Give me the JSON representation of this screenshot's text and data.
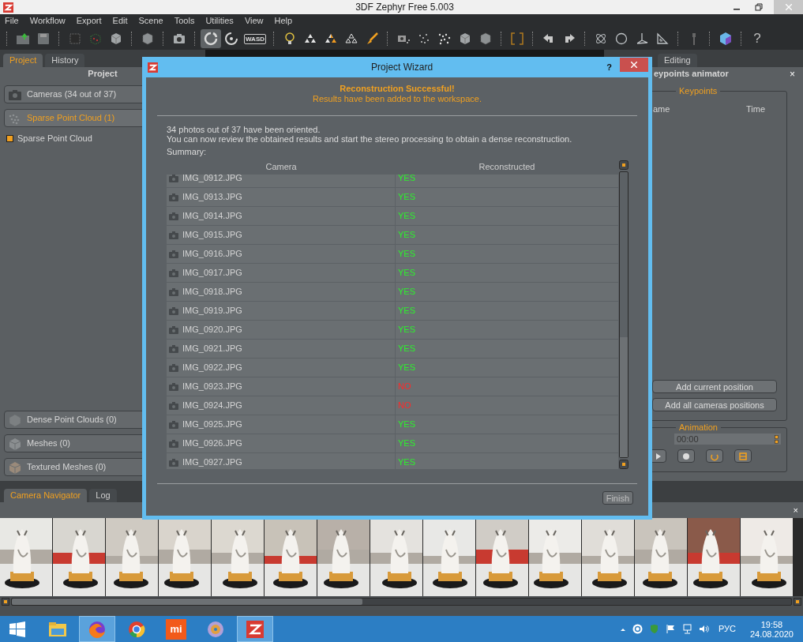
{
  "window": {
    "title": "3DF Zephyr Free 5.003"
  },
  "menu": [
    "File",
    "Workflow",
    "Export",
    "Edit",
    "Scene",
    "Tools",
    "Utilities",
    "View",
    "Help"
  ],
  "toolbar": [
    {
      "kind": "sep"
    },
    {
      "kind": "open",
      "selected": false
    },
    {
      "kind": "save",
      "selected": false
    },
    {
      "kind": "sep"
    },
    {
      "kind": "dotcube",
      "selected": false
    },
    {
      "kind": "pointcube",
      "selected": false
    },
    {
      "kind": "cube",
      "selected": false
    },
    {
      "kind": "sep"
    },
    {
      "kind": "meshcube",
      "selected": false
    },
    {
      "kind": "sep"
    },
    {
      "kind": "camera",
      "selected": false
    },
    {
      "kind": "sep"
    },
    {
      "kind": "rotate",
      "selected": true
    },
    {
      "kind": "orbit",
      "selected": false
    },
    {
      "kind": "wasd",
      "label": "WASD",
      "selected": false
    },
    {
      "kind": "sep"
    },
    {
      "kind": "bulb",
      "selected": false
    },
    {
      "kind": "triangles",
      "selected": false
    },
    {
      "kind": "triangles2",
      "selected": false
    },
    {
      "kind": "triangles3",
      "selected": false
    },
    {
      "kind": "brush",
      "selected": false
    },
    {
      "kind": "sep"
    },
    {
      "kind": "camerapoint",
      "selected": false
    },
    {
      "kind": "dots",
      "selected": false
    },
    {
      "kind": "dots2",
      "selected": false
    },
    {
      "kind": "cube",
      "selected": false
    },
    {
      "kind": "meshcube",
      "selected": false
    },
    {
      "kind": "sep"
    },
    {
      "kind": "bracket",
      "selected": false
    },
    {
      "kind": "sep"
    },
    {
      "kind": "undo",
      "selected": false
    },
    {
      "kind": "redo",
      "selected": false
    },
    {
      "kind": "sep"
    },
    {
      "kind": "atom",
      "selected": false
    },
    {
      "kind": "circle",
      "selected": false
    },
    {
      "kind": "axes",
      "selected": false
    },
    {
      "kind": "ruler",
      "selected": false
    },
    {
      "kind": "sep"
    },
    {
      "kind": "wrench",
      "selected": false
    },
    {
      "kind": "sep"
    },
    {
      "kind": "logo",
      "selected": false
    },
    {
      "kind": "sep"
    },
    {
      "kind": "help",
      "label": "?",
      "selected": false
    }
  ],
  "left_panel": {
    "tabs": [
      {
        "label": "Project",
        "selected": true
      },
      {
        "label": "History",
        "selected": false
      }
    ],
    "title": "Project",
    "sections": [
      {
        "label": "Cameras (34 out of 37)",
        "kind": "camera",
        "selected": false
      },
      {
        "label": "Sparse Point Cloud (1)",
        "kind": "points",
        "selected": true
      }
    ],
    "items": [
      {
        "label": "Sparse Point Cloud",
        "checked": true
      }
    ],
    "bottom_sections": [
      {
        "label": "Dense Point Clouds (0)",
        "kind": "dense",
        "selected": false
      },
      {
        "label": "Meshes (0)",
        "kind": "mesh",
        "selected": false
      },
      {
        "label": "Textured Meshes (0)",
        "kind": "textured",
        "selected": false
      }
    ]
  },
  "right_panel": {
    "tabs": [
      {
        "label": "Editing",
        "selected": false
      }
    ],
    "title": "eypoints animator",
    "close": "×",
    "keypoints": {
      "title": "Keypoints",
      "columns": [
        "ame",
        "Time"
      ],
      "buttons": [
        "Add current position",
        "Add all cameras positions"
      ]
    },
    "animation": {
      "title": "Animation",
      "time": "00:00",
      "buttons": [
        {
          "kind": "play"
        },
        {
          "kind": "record"
        },
        {
          "kind": "loop"
        },
        {
          "kind": "film"
        }
      ]
    }
  },
  "dialog": {
    "title": "Project Wizard",
    "help": "?",
    "heading": "Reconstruction Successful!",
    "subheading": "Results have been added to the workspace.",
    "lines": [
      "34 photos out of 37 have been oriented.",
      "You can now review the obtained results and start the stereo processing to obtain a dense reconstruction.",
      "Summary:"
    ],
    "columns": [
      "Camera",
      "Reconstructed"
    ],
    "rows": [
      {
        "camera": "IMG_0912.JPG",
        "reconstructed": "YES",
        "ok": true
      },
      {
        "camera": "IMG_0913.JPG",
        "reconstructed": "YES",
        "ok": true
      },
      {
        "camera": "IMG_0914.JPG",
        "reconstructed": "YES",
        "ok": true
      },
      {
        "camera": "IMG_0915.JPG",
        "reconstructed": "YES",
        "ok": true
      },
      {
        "camera": "IMG_0916.JPG",
        "reconstructed": "YES",
        "ok": true
      },
      {
        "camera": "IMG_0917.JPG",
        "reconstructed": "YES",
        "ok": true
      },
      {
        "camera": "IMG_0918.JPG",
        "reconstructed": "YES",
        "ok": true
      },
      {
        "camera": "IMG_0919.JPG",
        "reconstructed": "YES",
        "ok": true
      },
      {
        "camera": "IMG_0920.JPG",
        "reconstructed": "YES",
        "ok": true
      },
      {
        "camera": "IMG_0921.JPG",
        "reconstructed": "YES",
        "ok": true
      },
      {
        "camera": "IMG_0922.JPG",
        "reconstructed": "YES",
        "ok": true
      },
      {
        "camera": "IMG_0923.JPG",
        "reconstructed": "NO",
        "ok": false
      },
      {
        "camera": "IMG_0924.JPG",
        "reconstructed": "NO",
        "ok": false
      },
      {
        "camera": "IMG_0925.JPG",
        "reconstructed": "YES",
        "ok": true
      },
      {
        "camera": "IMG_0926.JPG",
        "reconstructed": "YES",
        "ok": true
      },
      {
        "camera": "IMG_0927.JPG",
        "reconstructed": "YES",
        "ok": true
      }
    ],
    "button": "Finish"
  },
  "bottom_panel": {
    "tabs": [
      {
        "label": "Camera Navigator",
        "selected": true
      },
      {
        "label": "Log",
        "selected": false
      }
    ],
    "close": "×"
  },
  "taskbar": {
    "apps": [
      {
        "kind": "explorer",
        "active": false
      },
      {
        "kind": "firefox",
        "active": true
      },
      {
        "kind": "chrome",
        "active": false
      },
      {
        "kind": "mi",
        "label": "mi",
        "active": false
      },
      {
        "kind": "disc",
        "active": false
      },
      {
        "kind": "zephyr",
        "active": true
      }
    ],
    "language": "РУС",
    "time": "19:58",
    "date": "24.08.2020"
  }
}
